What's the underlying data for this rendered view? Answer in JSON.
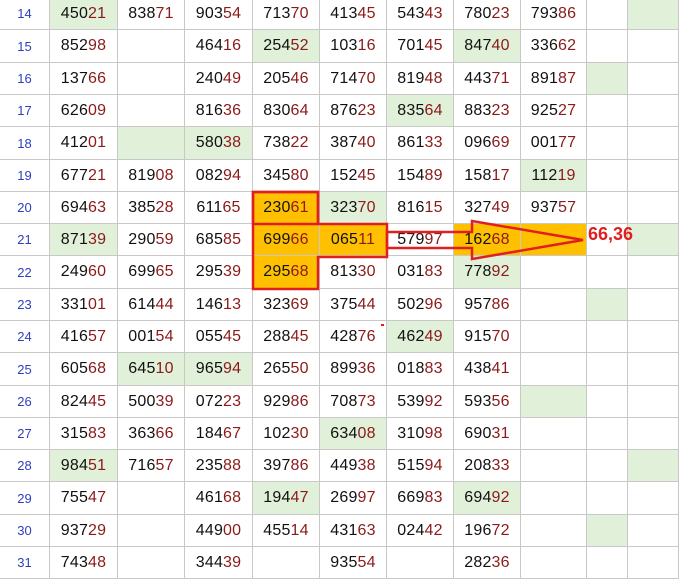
{
  "colors": {
    "green_cell": "#e0f0d9",
    "orange_cell": "#ffc000",
    "row_number": "#2e3fbf",
    "digit_dark": "#111111",
    "digit_red": "#8b1a1a",
    "annotation": "#e02020"
  },
  "annotation": {
    "text": "66,36"
  },
  "rows": [
    {
      "num": "14",
      "cells": [
        "45021",
        "83871",
        "90354",
        "71370",
        "41345",
        "54343",
        "78023",
        "79386",
        "",
        ""
      ],
      "green": [
        0,
        9
      ],
      "orange": []
    },
    {
      "num": "15",
      "cells": [
        "85298",
        "",
        "46416",
        "25452",
        "10316",
        "70145",
        "84740",
        "33662",
        "",
        ""
      ],
      "green": [
        3,
        6
      ],
      "orange": []
    },
    {
      "num": "16",
      "cells": [
        "13766",
        "",
        "24049",
        "20546",
        "71470",
        "81948",
        "44371",
        "89187",
        "",
        ""
      ],
      "green": [
        8
      ],
      "orange": []
    },
    {
      "num": "17",
      "cells": [
        "62609",
        "",
        "81636",
        "83064",
        "87623",
        "83564",
        "88323",
        "92527",
        "",
        ""
      ],
      "green": [
        5
      ],
      "orange": []
    },
    {
      "num": "18",
      "cells": [
        "41201",
        "",
        "58038",
        "73822",
        "38740",
        "86133",
        "09669",
        "00177",
        "",
        ""
      ],
      "green": [
        1,
        2
      ],
      "orange": []
    },
    {
      "num": "19",
      "cells": [
        "67721",
        "81908",
        "08294",
        "34580",
        "15245",
        "15489",
        "15817",
        "11219",
        "",
        ""
      ],
      "green": [
        7
      ],
      "orange": []
    },
    {
      "num": "20",
      "cells": [
        "69463",
        "38528",
        "61165",
        "23061",
        "32370",
        "81615",
        "32749",
        "93757",
        "",
        ""
      ],
      "green": [
        4
      ],
      "orange": [
        3
      ]
    },
    {
      "num": "21",
      "cells": [
        "87139",
        "29059",
        "68585",
        "69966",
        "06511",
        "57997",
        "16268",
        "",
        "",
        ""
      ],
      "green": [
        0,
        9
      ],
      "orange": [
        3,
        4,
        6,
        7
      ]
    },
    {
      "num": "22",
      "cells": [
        "24960",
        "69965",
        "29539",
        "29568",
        "81330",
        "03183",
        "77892",
        "",
        "",
        ""
      ],
      "green": [
        6
      ],
      "orange": [
        3
      ]
    },
    {
      "num": "23",
      "cells": [
        "33101",
        "61444",
        "14613",
        "32369",
        "37544",
        "50296",
        "95786",
        "",
        "",
        ""
      ],
      "green": [
        8
      ],
      "orange": []
    },
    {
      "num": "24",
      "cells": [
        "41657",
        "00154",
        "05545",
        "28845",
        "42876",
        "46249",
        "91570",
        "",
        "",
        ""
      ],
      "green": [
        5
      ],
      "orange": []
    },
    {
      "num": "25",
      "cells": [
        "60568",
        "64510",
        "96594",
        "26550",
        "89936",
        "01883",
        "43841",
        "",
        "",
        ""
      ],
      "green": [
        1,
        2
      ],
      "orange": []
    },
    {
      "num": "26",
      "cells": [
        "82445",
        "50039",
        "07223",
        "92986",
        "70873",
        "53992",
        "59356",
        "",
        "",
        ""
      ],
      "green": [
        7
      ],
      "orange": []
    },
    {
      "num": "27",
      "cells": [
        "31583",
        "36366",
        "18467",
        "10230",
        "63408",
        "31098",
        "69031",
        "",
        "",
        ""
      ],
      "green": [
        4
      ],
      "orange": []
    },
    {
      "num": "28",
      "cells": [
        "98451",
        "71657",
        "23588",
        "39786",
        "44938",
        "51594",
        "20833",
        "",
        "",
        ""
      ],
      "green": [
        0,
        9
      ],
      "orange": []
    },
    {
      "num": "29",
      "cells": [
        "75547",
        "",
        "46168",
        "19447",
        "26997",
        "66983",
        "69492",
        "",
        "",
        ""
      ],
      "green": [
        3,
        6
      ],
      "orange": []
    },
    {
      "num": "30",
      "cells": [
        "93729",
        "",
        "44900",
        "45514",
        "43163",
        "02442",
        "19672",
        "",
        "",
        ""
      ],
      "green": [
        8
      ],
      "orange": []
    },
    {
      "num": "31",
      "cells": [
        "74348",
        "",
        "34439",
        "",
        "93554",
        "",
        "28236",
        "",
        "",
        ""
      ],
      "green": [],
      "orange": []
    }
  ]
}
